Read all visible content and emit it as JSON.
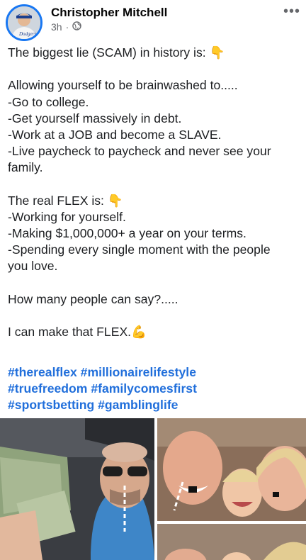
{
  "post": {
    "author": "Christopher Mitchell",
    "time": "3h",
    "privacy_icon": "globe-icon",
    "more_icon": "more-options-icon",
    "body_lines": [
      "The biggest lie (SCAM) in history is: 👇",
      "",
      "Allowing yourself to be brainwashed to.....",
      "-Go to college.",
      "-Get yourself massively in debt.",
      "-Work at a JOB and become a SLAVE.",
      "-Live paycheck to paycheck and never see your",
      "family.",
      "",
      "The real FLEX is: 👇",
      "-Working for yourself.",
      "-Making $1,000,000+ a year on your terms.",
      "-Spending every single moment with the people",
      "you love.",
      "",
      "How many people can say?.....",
      "",
      "I can make that FLEX.💪"
    ],
    "hashtag_lines": [
      "#therealflex #millionairelifestyle",
      "#truefreedom #familycomesfirst",
      "#sportsbetting #gamblinglife"
    ]
  },
  "colors": {
    "accent": "#1877f2",
    "hashtag": "#216fdb",
    "meta": "#65676b"
  }
}
